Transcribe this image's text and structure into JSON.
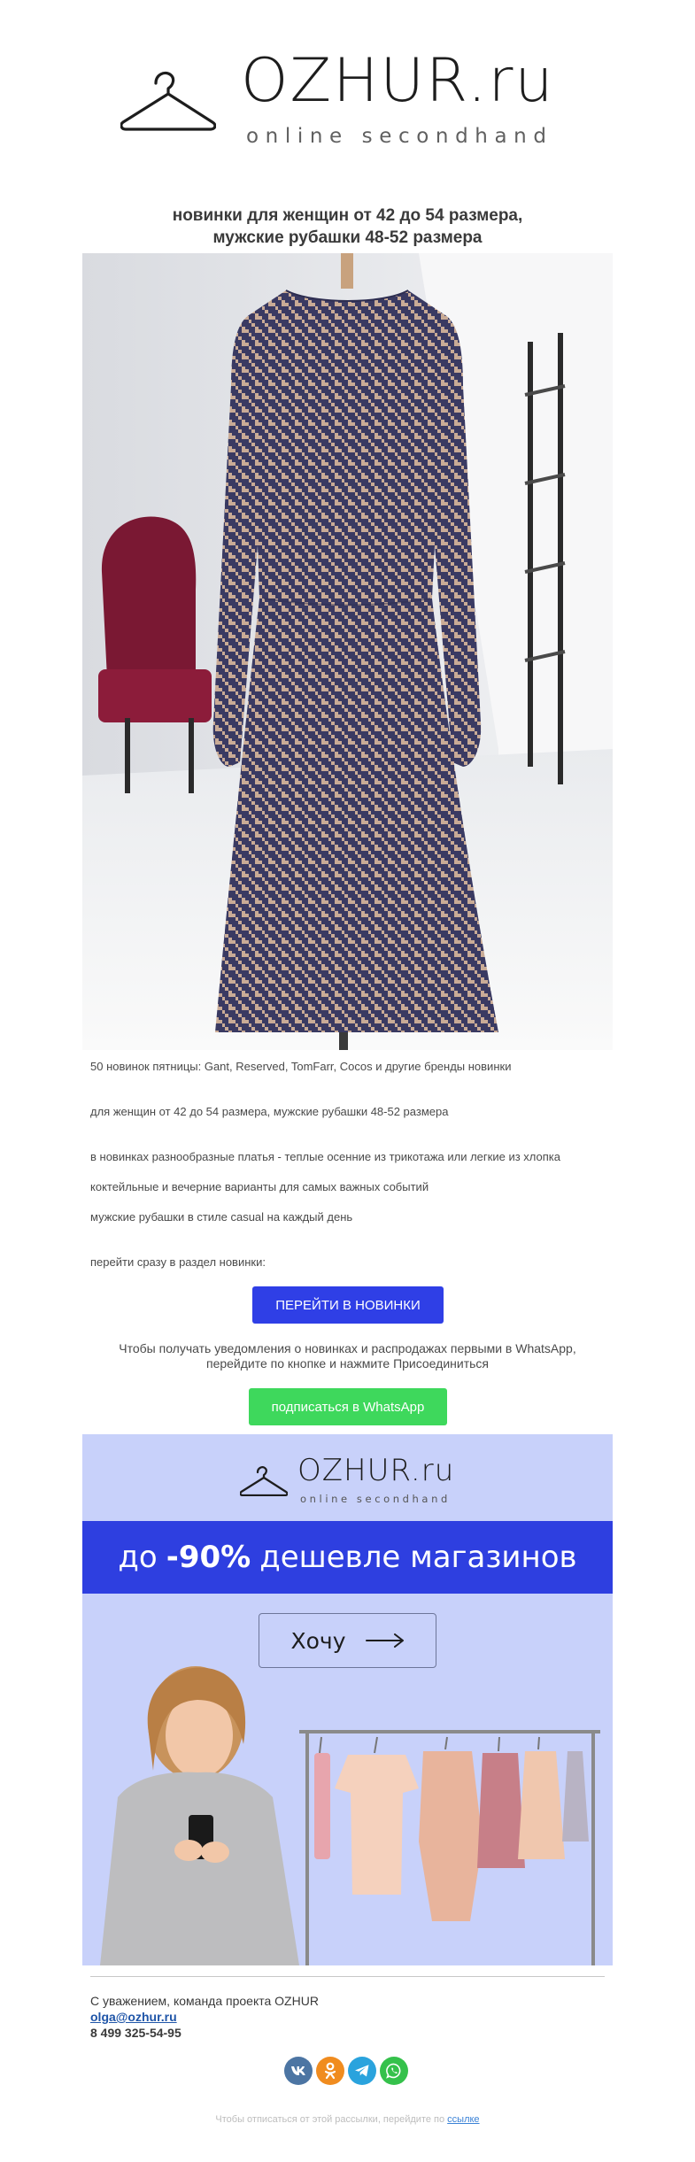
{
  "brand": {
    "name": "OZHUR.ru",
    "tagline": "online secondhand"
  },
  "headline": {
    "line1": "новинки для женщин от 42 до 54 размера,",
    "line2": "мужские рубашки 48-52 размера"
  },
  "body": {
    "p1": "50 новинок пятницы: Gant, Reserved, TomFarr, Cocos и другие бренды новинки",
    "p2": "для женщин от 42 до 54 размера, мужские рубашки 48-52 размера",
    "p3": "в новинках разнообразные платья - теплые осенние из трикотажа или легкие из хлопка",
    "p4": "коктейльные и вечерние варианты для самых важных событий",
    "p5": "мужские рубашки в стиле casual на каждый день",
    "p6": "перейти сразу в раздел новинки:"
  },
  "buttons": {
    "catalog": "ПЕРЕЙТИ В НОВИНКИ",
    "whatsapp": "подписаться в WhatsApp"
  },
  "whatsapp_note": {
    "line1": "Чтобы получать уведомления о новинках и распродажах первыми в WhatsApp,",
    "line2": "перейдите по кнопке и нажмите Присоединиться"
  },
  "promo": {
    "brand_name": "OZHUR.ru",
    "brand_tagline": "online secondhand",
    "banner_prefix": "до",
    "banner_highlight": "-90%",
    "banner_suffix": "дешевле магазинов",
    "cta": "Хочу"
  },
  "footer": {
    "regards": "С уважением, команда проекта OZHUR",
    "email": "olga@ozhur.ru",
    "phone": "8 499 325-54-95",
    "unsubscribe_text": "Чтобы отписаться от этой рассылки, перейдите по",
    "unsubscribe_link": "ссылке"
  },
  "socials": [
    "vk-icon",
    "odnoklassniki-icon",
    "telegram-icon",
    "whatsapp-icon"
  ],
  "colors": {
    "catalog_button": "#2f3fe6",
    "whatsapp_button": "#3ed85c",
    "promo_background": "#c8d1fa",
    "promo_band": "#2e3fe0",
    "link": "#1f55a8"
  }
}
